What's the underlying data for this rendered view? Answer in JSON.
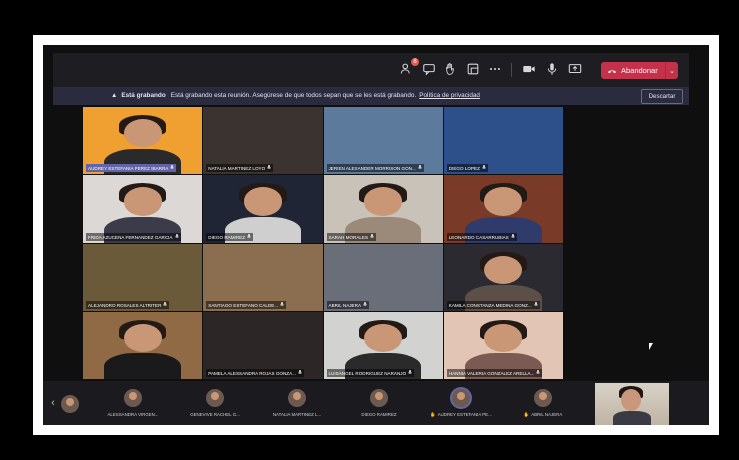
{
  "toolbar": {
    "participants_badge": "8",
    "leave_label": "Abandonar"
  },
  "banner": {
    "title": "Está grabando",
    "message": "Está grabando esta reunión. Asegúrese de que todos sepan que se les está grabando.",
    "link": "Política de privacidad",
    "dismiss": "Descartar"
  },
  "grid": {
    "tiles": [
      {
        "name": "AUDREY ESTEFANIA PEREZ IBARRA",
        "bg": "#f0a030",
        "body": "#2a2a2a",
        "person": true,
        "highlight": true
      },
      {
        "name": "NATALIA MARTINEZ LOYO",
        "bg": "#3a332f",
        "body": "#2a2a2a",
        "person": false
      },
      {
        "name": "JERIEN ALEXANDER MORRISON GON...",
        "bg": "#5c7a9c",
        "body": "#2a2a2a",
        "person": false
      },
      {
        "name": "DIEGO LOPEZ",
        "bg": "#2d4f8a",
        "body": "#2a2a2a",
        "person": false
      },
      {
        "name": "FRIDA AZUCENA FERNANDEZ GARCIA",
        "bg": "#dcd8d5",
        "body": "#3b3b4a",
        "person": true
      },
      {
        "name": "DIEGO RAMIREZ",
        "bg": "#1f2535",
        "body": "#cfcfcf",
        "person": true
      },
      {
        "name": "SARAH MORALES",
        "bg": "#c9c2b9",
        "body": "#9b8a7a",
        "person": true
      },
      {
        "name": "LEONARDO CASARRUBIAS",
        "bg": "#7a3a28",
        "body": "#2f3b6b",
        "person": true
      },
      {
        "name": "ALEJANDRO ROSALES ALTRITER",
        "bg": "#6b5a3a",
        "body": "#2a2a2a",
        "person": false
      },
      {
        "name": "SANTIAGO ESTEFANO CALDE...",
        "bg": "#8a6e4f",
        "body": "#2a2a2a",
        "person": false
      },
      {
        "name": "ABRIL NAJERA",
        "bg": "#6a6e78",
        "body": "#2a2a2a",
        "person": false
      },
      {
        "name": "KAMILA CONSTANZA MEDINA GONZ...",
        "bg": "#2a2a30",
        "body": "#5c4f47",
        "person": true
      },
      {
        "name": "",
        "bg": "#8f6a45",
        "body": "#1a1a1a",
        "person": true
      },
      {
        "name": "PAMELA ALESSANDRA ROJAS GONZA...",
        "bg": "#2d2626",
        "body": "#2a2a2a",
        "person": false
      },
      {
        "name": "LUISANGEL RODRIGUEZ NARANJO",
        "bg": "#d2d2d0",
        "body": "#2a2a2a",
        "person": true
      },
      {
        "name": "HANNIA VALERIA GONZALEZ ARELLA...",
        "bg": "#e3c5b5",
        "body": "#7b5a54",
        "person": true
      }
    ]
  },
  "strip": {
    "thumbs": [
      {
        "name": "ALESSANDRA VIRGEN...",
        "hand": false
      },
      {
        "name": "GENEVIVE RACHEL G...",
        "hand": false
      },
      {
        "name": "NATALIA MARTINEZ L...",
        "hand": false
      },
      {
        "name": "DIEGO RAMIREZ",
        "hand": false
      },
      {
        "name": "AUDREY ESTEFANIA PE...",
        "hand": true
      },
      {
        "name": "ABRIL NAJERA",
        "hand": true
      }
    ]
  }
}
